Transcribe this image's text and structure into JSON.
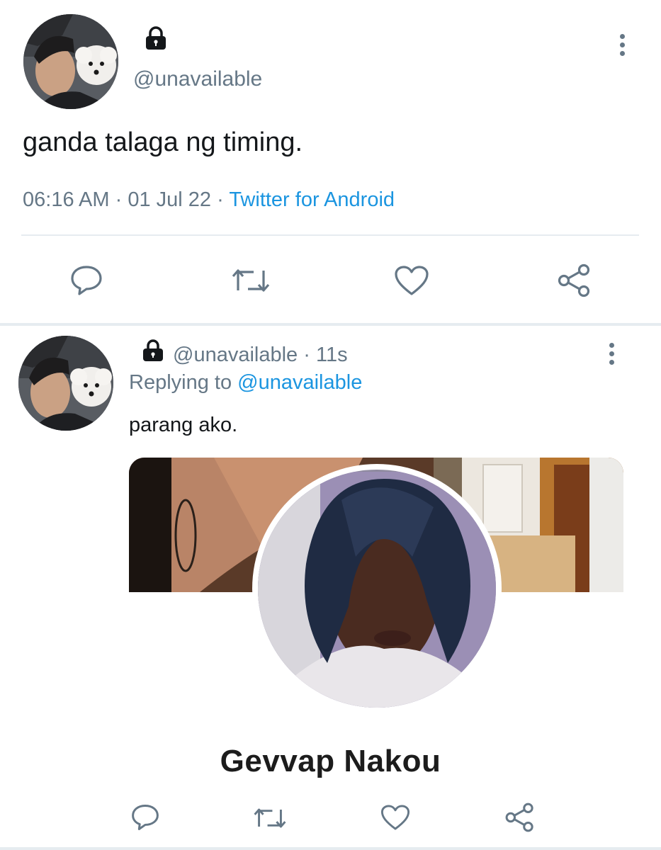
{
  "main_tweet": {
    "avatar_icon": "user-avatar-with-dog",
    "lock_icon": "lock-icon",
    "handle": "@unavailable",
    "text": "ganda talaga ng timing.",
    "time": "06:16 AM",
    "date": "01 Jul 22",
    "separator": "·",
    "source": "Twitter for Android",
    "actions": [
      "reply-icon",
      "retweet-icon",
      "like-icon",
      "share-icon"
    ]
  },
  "reply_tweet": {
    "avatar_icon": "user-avatar-with-dog",
    "handle": "@unavailable",
    "separator": "·",
    "time_ago": "11s",
    "replying_prefix": "Replying to",
    "replying_to": "@unavailable",
    "text": "parang ako.",
    "media_caption": "Gevvap Nakou",
    "actions": [
      "reply-icon",
      "retweet-icon",
      "like-icon",
      "share-icon"
    ]
  },
  "colors": {
    "text_primary": "#14171a",
    "text_secondary": "#657786",
    "link": "#1b95e0",
    "divider": "#e6ecf0"
  }
}
